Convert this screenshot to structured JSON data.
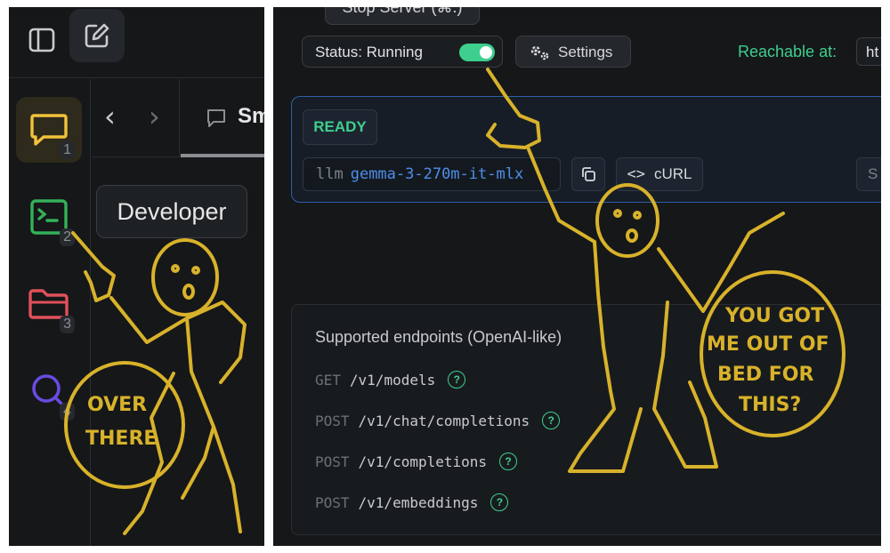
{
  "left": {
    "tab_label": "Sm",
    "tooltip": "Developer",
    "rail": [
      {
        "icon": "chat-icon",
        "number": "1",
        "color": "#f2c23a"
      },
      {
        "icon": "terminal-icon",
        "number": "2",
        "color": "#34b05a"
      },
      {
        "icon": "folder-icon",
        "number": "3",
        "color": "#e0505a"
      },
      {
        "icon": "search-icon",
        "number": "4",
        "color": "#6a4be0"
      }
    ],
    "nav": {
      "back": "‹",
      "forward": "›"
    }
  },
  "server": {
    "stop_label": "Stop Server (⌘.)",
    "status_label": "Status: Running",
    "status_on": true,
    "settings_label": "Settings",
    "reachable_label": "Reachable at:",
    "reachable_url_partial": "ht",
    "ready_badge": "READY",
    "model_prefix": "llm",
    "model_name": "gemma-3-270m-it-mlx",
    "curl_brackets": "<>",
    "curl_label": "cURL",
    "cut_button": "S"
  },
  "endpoints": {
    "title": "Supported endpoints (OpenAI-like)",
    "items": [
      {
        "method": "GET",
        "path": "/v1/models"
      },
      {
        "method": "POST",
        "path": "/v1/chat/completions"
      },
      {
        "method": "POST",
        "path": "/v1/completions"
      },
      {
        "method": "POST",
        "path": "/v1/embeddings"
      }
    ],
    "help_glyph": "?"
  },
  "annotations": {
    "left_bubble": [
      "OVER",
      "THERE"
    ],
    "right_bubble": [
      "YOU GOT",
      "ME OUT OF",
      "BED FOR",
      "THIS?"
    ],
    "ink_color": "#d8b22a"
  }
}
